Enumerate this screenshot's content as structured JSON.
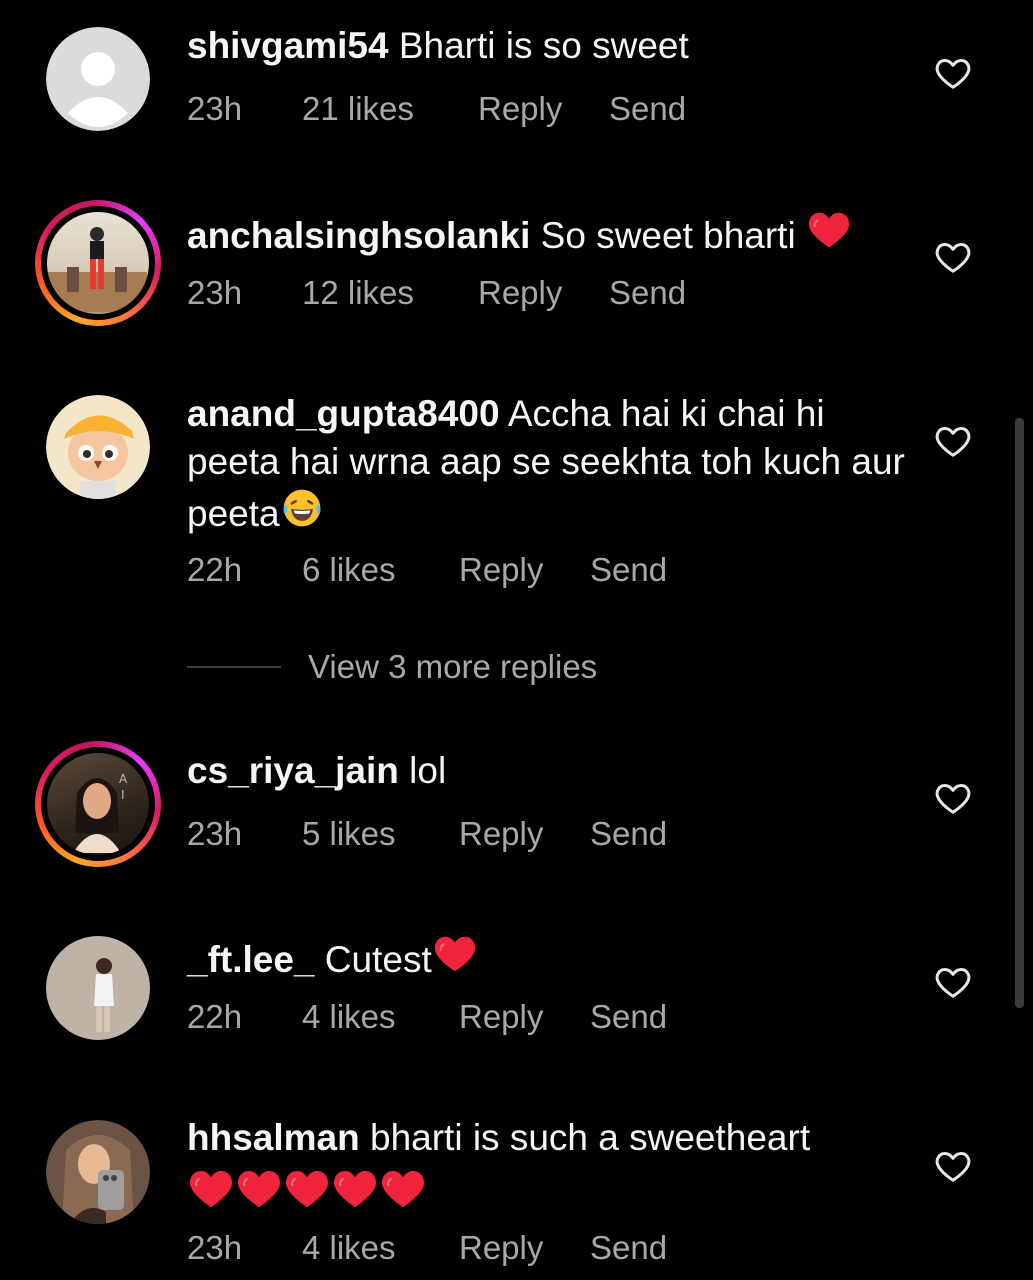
{
  "comments": [
    {
      "username": "shivgami54",
      "text": "Bharti is so sweet",
      "time": "23h",
      "likes": "21 likes",
      "reply": "Reply",
      "send": "Send"
    },
    {
      "username": "anchalsinghsolanki",
      "text": "So sweet bharti",
      "time": "23h",
      "likes": "12 likes",
      "reply": "Reply",
      "send": "Send"
    },
    {
      "username": "anand_gupta8400",
      "text": "Accha hai ki chai hi peeta hai wrna aap se seekhta toh kuch aur peeta",
      "time": "22h",
      "likes": "6 likes",
      "reply": "Reply",
      "send": "Send"
    },
    {
      "username": "cs_riya_jain",
      "text": "lol",
      "time": "23h",
      "likes": "5 likes",
      "reply": "Reply",
      "send": "Send"
    },
    {
      "username": "_ft.lee_",
      "text": "Cutest",
      "time": "22h",
      "likes": "4 likes",
      "reply": "Reply",
      "send": "Send"
    },
    {
      "username": "hhsalman",
      "text": "bharti is such a sweetheart",
      "time": "23h",
      "likes": "4 likes",
      "reply": "Reply",
      "send": "Send"
    }
  ],
  "view_more_replies": "View 3 more replies",
  "icons": {
    "like": "heart-outline-icon",
    "red_heart": "red-heart-emoji",
    "laugh": "tears-of-joy-emoji"
  },
  "colors": {
    "background": "#000000",
    "text": "#f5f5f5",
    "meta": "#a8a8a8",
    "heart": "#f0243c"
  }
}
